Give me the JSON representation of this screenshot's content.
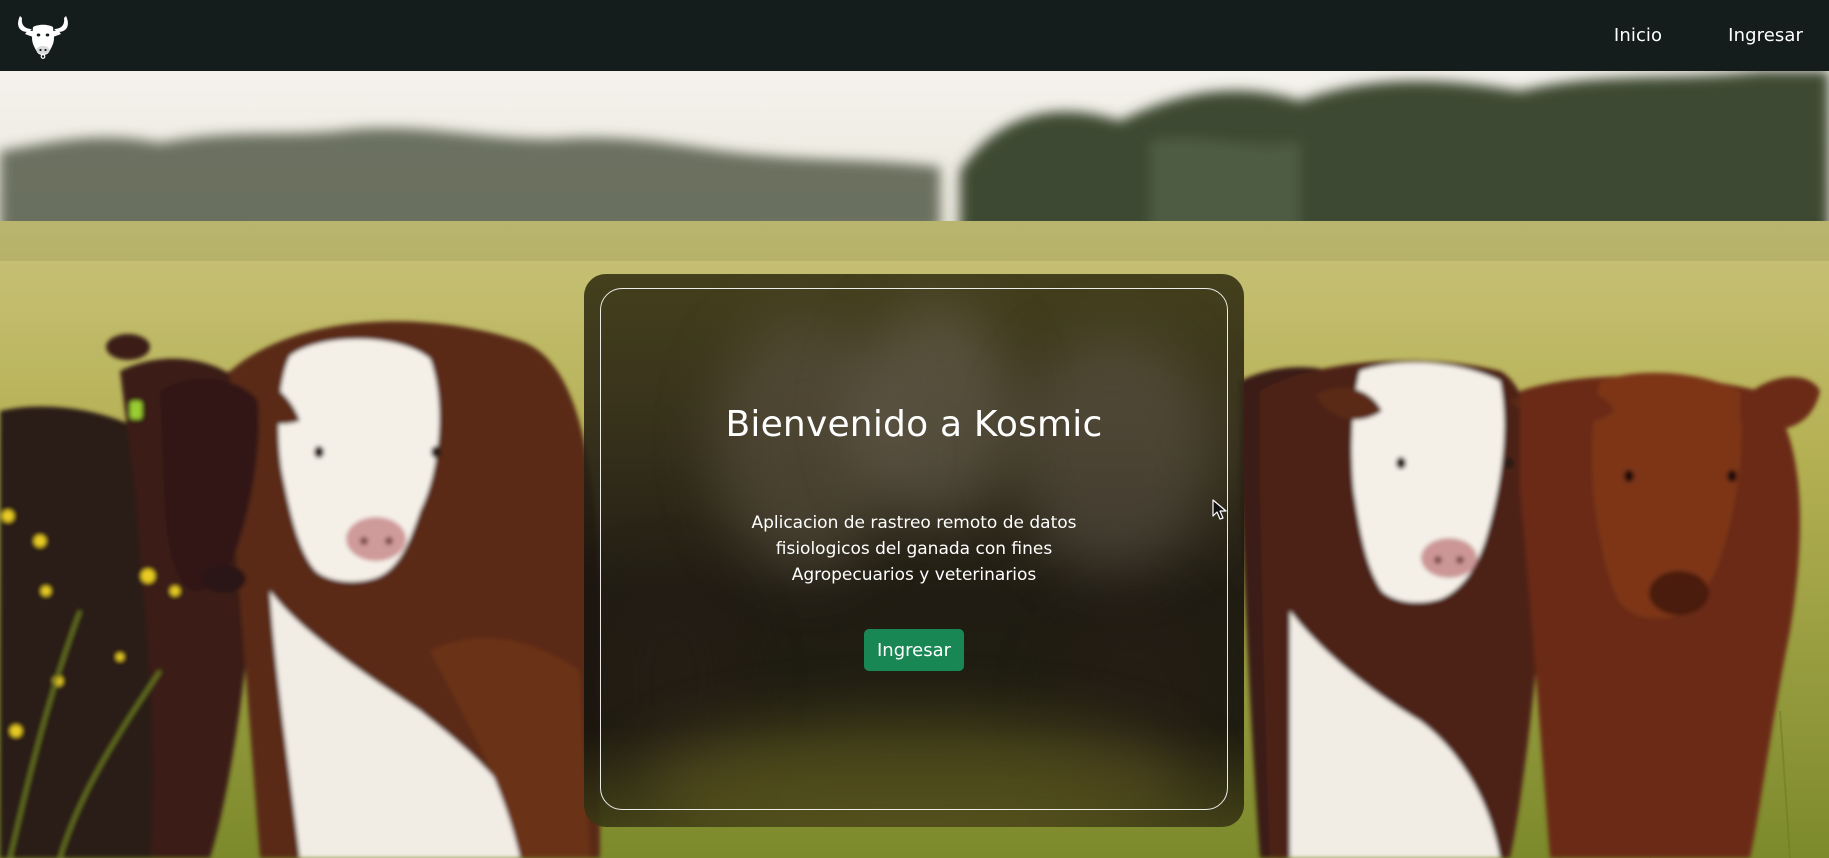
{
  "navbar": {
    "logo_icon": "bull-head-icon",
    "links": [
      {
        "label": "Inicio"
      },
      {
        "label": "Ingresar"
      }
    ]
  },
  "hero": {
    "background_image": "cattle-in-meadow-photo"
  },
  "welcome_card": {
    "title": "Bienvenido a Kosmic",
    "description": "Aplicacion de rastreo remoto de datos fisiologicos del ganada con fines Agropecuarios y veterinarios",
    "button_label": "Ingresar"
  },
  "colors": {
    "navbar_bg": "#141c1c",
    "button_bg": "#198754",
    "text": "#ffffff"
  }
}
